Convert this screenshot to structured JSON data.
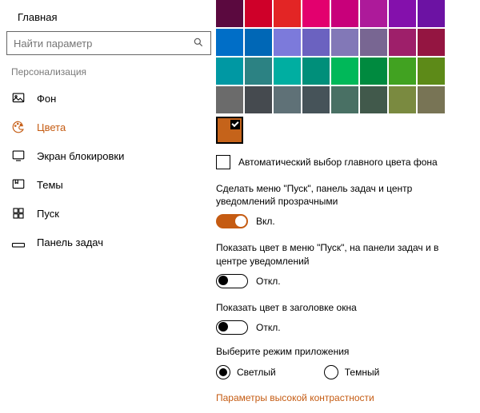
{
  "sidebar": {
    "home": "Главная",
    "search_placeholder": "Найти параметр",
    "section": "Персонализация",
    "items": [
      {
        "label": "Фон",
        "active": false
      },
      {
        "label": "Цвета",
        "active": true
      },
      {
        "label": "Экран блокировки",
        "active": false
      },
      {
        "label": "Темы",
        "active": false
      },
      {
        "label": "Пуск",
        "active": false
      },
      {
        "label": "Панель задач",
        "active": false
      }
    ]
  },
  "colors": {
    "rows": [
      [
        "#5b093f",
        "#cf0029",
        "#e32525",
        "#e3006e",
        "#c8007a",
        "#ad1a9a",
        "#8410ac",
        "#6c12a3"
      ],
      [
        "#006ec7",
        "#0067b6",
        "#7c7adb",
        "#6b62c0",
        "#8278b7",
        "#786692",
        "#9e1f6a",
        "#941541"
      ],
      [
        "#0098a3",
        "#2c8283",
        "#00aea1",
        "#008f7a",
        "#00b859",
        "#008a3f",
        "#41a221",
        "#5d8a18"
      ],
      [
        "#6b6b6b",
        "#454a4f",
        "#5f7177",
        "#465359",
        "#497064",
        "#41594b",
        "#7a8a40",
        "#787455"
      ]
    ],
    "selected": "#c5631a",
    "auto_label": "Автоматический выбор главного цвета фона",
    "auto_checked": false,
    "transparency_label": "Сделать меню \"Пуск\", панель задач и центр уведомлений прозрачными",
    "transparency_state": "Вкл.",
    "transparency_on": true,
    "show_color_label": "Показать цвет в меню \"Пуск\", на панели задач и в центре уведомлений",
    "show_color_state": "Откл.",
    "show_color_on": false,
    "title_color_label": "Показать цвет в заголовке окна",
    "title_color_state": "Откл.",
    "title_color_on": false,
    "app_mode_label": "Выберите режим приложения",
    "app_mode_options": [
      {
        "label": "Светлый",
        "selected": true
      },
      {
        "label": "Темный",
        "selected": false
      }
    ],
    "high_contrast_link": "Параметры высокой контрастности"
  }
}
